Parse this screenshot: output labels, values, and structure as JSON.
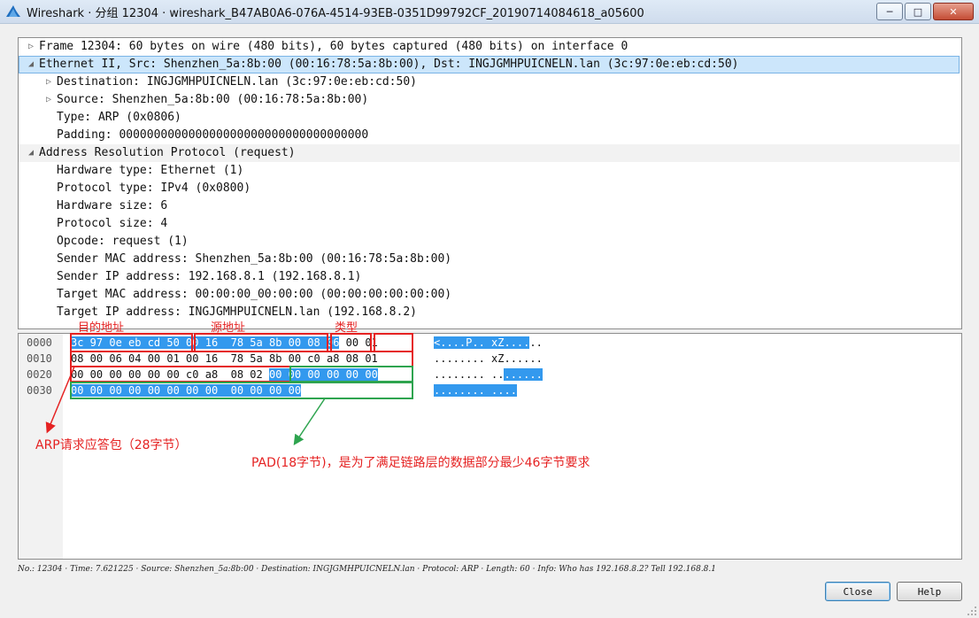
{
  "window": {
    "title": "Wireshark · 分组 12304 · wireshark_B47AB0A6-076A-4514-93EB-0351D99792CF_20190714084618_a05600",
    "minimize": "─",
    "maximize": "□",
    "close": "✕"
  },
  "details": {
    "rows": [
      {
        "text": "Frame 12304: 60 bytes on wire (480 bits), 60 bytes captured (480 bits) on interface 0",
        "expander": "collapsed"
      },
      {
        "text": "Ethernet II, Src: Shenzhen_5a:8b:00 (00:16:78:5a:8b:00), Dst: INGJGMHPUICNELN.lan (3c:97:0e:eb:cd:50)",
        "expander": "expanded"
      },
      {
        "text": "Destination: INGJGMHPUICNELN.lan (3c:97:0e:eb:cd:50)",
        "expander": "collapsed"
      },
      {
        "text": "Source: Shenzhen_5a:8b:00 (00:16:78:5a:8b:00)",
        "expander": "collapsed"
      },
      {
        "text": "Type: ARP (0x0806)",
        "expander": "none"
      },
      {
        "text": "Padding: 000000000000000000000000000000000000",
        "expander": "none"
      },
      {
        "text": "Address Resolution Protocol (request)",
        "expander": "expanded"
      },
      {
        "text": "Hardware type: Ethernet (1)",
        "expander": "none"
      },
      {
        "text": "Protocol type: IPv4 (0x0800)",
        "expander": "none"
      },
      {
        "text": "Hardware size: 6",
        "expander": "none"
      },
      {
        "text": "Protocol size: 4",
        "expander": "none"
      },
      {
        "text": "Opcode: request (1)",
        "expander": "none"
      },
      {
        "text": "Sender MAC address: Shenzhen_5a:8b:00 (00:16:78:5a:8b:00)",
        "expander": "none"
      },
      {
        "text": "Sender IP address: 192.168.8.1 (192.168.8.1)",
        "expander": "none"
      },
      {
        "text": "Target MAC address: 00:00:00_00:00:00 (00:00:00:00:00:00)",
        "expander": "none"
      },
      {
        "text": "Target IP address: INGJGMHPUICNELN.lan (192.168.8.2)",
        "expander": "none"
      }
    ]
  },
  "bytes": {
    "lines": [
      {
        "offset": "0000",
        "hex_hl": "3c 97 0e eb cd 50 00 16  78 5a 8b 00 08 06",
        "hex_plain": " 00 01",
        "ascii_hl": "<....P.. xZ....",
        "ascii_plain": ".."
      },
      {
        "offset": "0010",
        "hex_hl": "",
        "hex_plain": "08 00 06 04 00 01 00 16  78 5a 8b 00 c0 a8 08 01",
        "ascii_hl": "",
        "ascii_plain": "........ xZ......"
      },
      {
        "offset": "0020",
        "hex_plain": "00 00 00 00 00 00 c0 a8  08 02 ",
        "hex_hl": "00 00 00 00 00 00",
        "ascii_plain": "........ ..",
        "ascii_hl": "......"
      },
      {
        "offset": "0030",
        "hex_hl": "00 00 00 00 00 00 00 00  00 00 00 00",
        "hex_plain": "",
        "ascii_hl": "........ ....",
        "ascii_plain": ""
      }
    ]
  },
  "annotations": {
    "dest": "目的地址",
    "src": "源地址",
    "type": "类型",
    "arp": "ARP请求应答包（28字节）",
    "pad": "PAD(18字节)，是为了满足链路层的数据部分最少46字节要求"
  },
  "status": "No.: 12304 · Time: 7.621225 · Source: Shenzhen_5a:8b:00 · Destination: INGJGMHPUICNELN.lan · Protocol: ARP · Length: 60 · Info: Who has 192.168.8.2? Tell 192.168.8.1",
  "buttons": {
    "close": "Close",
    "help": "Help"
  },
  "colors": {
    "selection": "#3399ee",
    "annotation_red": "#e52222",
    "annotation_green": "#2ea44f"
  }
}
